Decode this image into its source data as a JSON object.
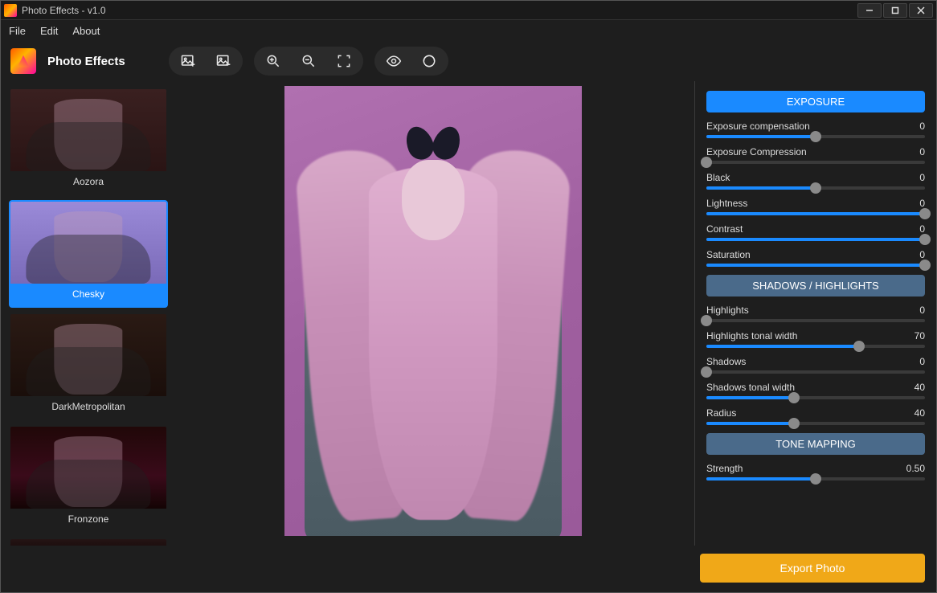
{
  "window": {
    "title": "Photo Effects - v1.0"
  },
  "menubar": [
    "File",
    "Edit",
    "About"
  ],
  "app": {
    "name": "Photo Effects"
  },
  "toolbar_groups": {
    "image": [
      "add-image-icon",
      "remove-image-icon"
    ],
    "zoom": [
      "zoom-in-icon",
      "zoom-out-icon",
      "fit-screen-icon"
    ],
    "view": [
      "eye-icon",
      "refresh-icon"
    ]
  },
  "presets": [
    {
      "name": "Aozora",
      "tint": "linear-gradient(180deg,#3a2020 0%,#2a1414 100%)",
      "selected": false
    },
    {
      "name": "Chesky",
      "tint": "linear-gradient(180deg,#9a8ad8 0%,#7a6ab8 100%)",
      "selected": true
    },
    {
      "name": "DarkMetropolitan",
      "tint": "linear-gradient(180deg,#2a1a14 0%,#1a0e0a 100%)",
      "selected": false
    },
    {
      "name": "Fronzone",
      "tint": "linear-gradient(180deg,#200808 0%,#3a0a1a 60%,#140404 100%)",
      "selected": false
    }
  ],
  "sections": {
    "exposure": {
      "title": "EXPOSURE",
      "active": true,
      "sliders": [
        {
          "label": "Exposure compensation",
          "value": "0",
          "pct": 50
        },
        {
          "label": "Exposure  Compression",
          "value": "0",
          "pct": 0
        },
        {
          "label": "Black",
          "value": "0",
          "pct": 50
        },
        {
          "label": "Lightness",
          "value": "0",
          "pct": 100
        },
        {
          "label": "Contrast",
          "value": "0",
          "pct": 100
        },
        {
          "label": "Saturation",
          "value": "0",
          "pct": 100
        }
      ]
    },
    "shadows": {
      "title": "SHADOWS / HIGHLIGHTS",
      "active": false,
      "sliders": [
        {
          "label": "Highlights",
          "value": "0",
          "pct": 0
        },
        {
          "label": "Highlights tonal width",
          "value": "70",
          "pct": 70
        },
        {
          "label": "Shadows",
          "value": "0",
          "pct": 0
        },
        {
          "label": "Shadows tonal width",
          "value": "40",
          "pct": 40
        },
        {
          "label": "Radius",
          "value": "40",
          "pct": 40
        }
      ]
    },
    "tone": {
      "title": "TONE MAPPING",
      "active": false,
      "sliders": [
        {
          "label": "Strength",
          "value": "0.50",
          "pct": 50
        }
      ]
    }
  },
  "footer": {
    "export_label": "Export Photo"
  }
}
